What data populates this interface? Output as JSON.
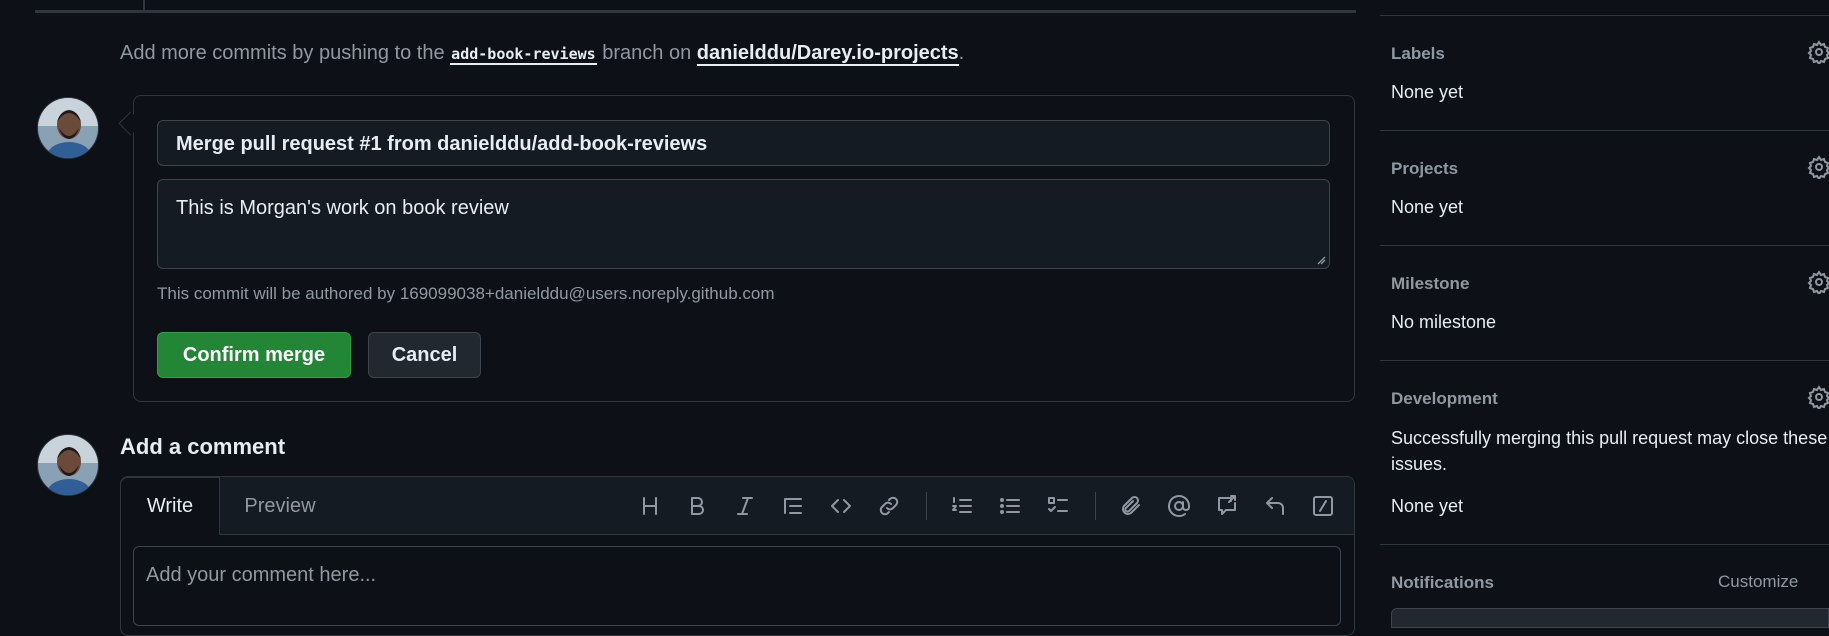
{
  "hint": {
    "prefix": "Add more commits by pushing to the",
    "branch": "add-book-reviews",
    "middle": "branch on",
    "repo": "danielddu/Darey.io-projects",
    "suffix": "."
  },
  "merge": {
    "title_value": "Merge pull request #1 from danielddu/add-book-reviews",
    "message_value": "This is Morgan's work on book review",
    "author_note": "This commit will be authored by 169099038+danielddu@users.noreply.github.com",
    "confirm_label": "Confirm merge",
    "cancel_label": "Cancel"
  },
  "comment": {
    "heading": "Add a comment",
    "tabs": [
      "Write",
      "Preview"
    ],
    "placeholder": "Add your comment here...",
    "toolbar_icons": [
      "heading-icon",
      "bold-icon",
      "italic-icon",
      "quote-icon",
      "code-icon",
      "link-icon",
      "ordered-list-icon",
      "unordered-list-icon",
      "task-list-icon",
      "attach-icon",
      "mention-icon",
      "reference-icon",
      "reply-icon",
      "slash-command-icon"
    ]
  },
  "sidebar": {
    "labels": {
      "title": "Labels",
      "value": "None yet"
    },
    "projects": {
      "title": "Projects",
      "value": "None yet"
    },
    "milestone": {
      "title": "Milestone",
      "value": "No milestone"
    },
    "development": {
      "title": "Development",
      "text": "Successfully merging this pull request may close these issues.",
      "value": "None yet"
    },
    "notifications": {
      "title": "Notifications",
      "customize": "Customize"
    }
  },
  "colors": {
    "background": "#0d1117",
    "border": "#30363d",
    "merge_green": "#238636",
    "muted_text": "#9198a1",
    "text": "#e6edf3"
  }
}
